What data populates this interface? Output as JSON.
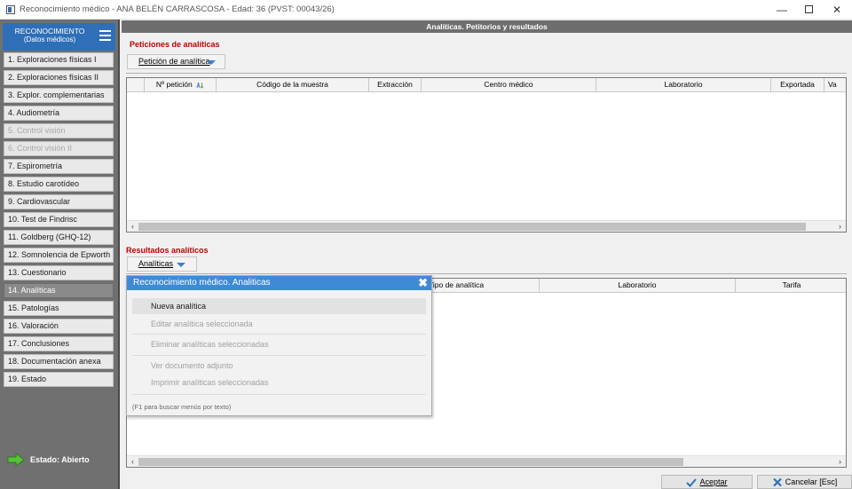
{
  "window": {
    "title": "Reconocimiento médico - ANA BELÉN CARRASCOSA  -  Edad: 36   (PVST: 00043/26)"
  },
  "sidebar": {
    "header_line1": "RECONOCIMIENTO",
    "header_line2": "(Datos médicos)",
    "items": [
      {
        "label": "1. Exploraciones físicas I",
        "state": "enabled"
      },
      {
        "label": "2. Exploraciones físicas II",
        "state": "enabled"
      },
      {
        "label": "3. Explor. complementarias",
        "state": "enabled"
      },
      {
        "label": "4. Audiometría",
        "state": "enabled"
      },
      {
        "label": "5. Control visión",
        "state": "disabled"
      },
      {
        "label": "6. Control visión II",
        "state": "disabled"
      },
      {
        "label": "7. Espirometría",
        "state": "enabled"
      },
      {
        "label": "8. Estudio carotídeo",
        "state": "enabled"
      },
      {
        "label": "9. Cardiovascular",
        "state": "enabled"
      },
      {
        "label": "10. Test de Findrisc",
        "state": "enabled"
      },
      {
        "label": "11. Goldberg (GHQ-12)",
        "state": "enabled"
      },
      {
        "label": "12. Somnolencia de Epworth",
        "state": "enabled"
      },
      {
        "label": "13. Cuestionario",
        "state": "enabled"
      },
      {
        "label": "14. Analíticas",
        "state": "selected"
      },
      {
        "label": "15. Patologías",
        "state": "enabled"
      },
      {
        "label": "16. Valoración",
        "state": "enabled"
      },
      {
        "label": "17. Conclusiones",
        "state": "enabled"
      },
      {
        "label": "18. Documentación anexa",
        "state": "enabled"
      },
      {
        "label": "19. Estado",
        "state": "enabled"
      }
    ],
    "status_label": "Estado: Abierto"
  },
  "main": {
    "header": "Analíticas. Petitorios y resultados",
    "peticiones": {
      "title": "Peticiones de analíticas",
      "button": "Petición de analítica",
      "columns": [
        "Nº petición",
        "Código de la muestra",
        "Extracción",
        "Centro médico",
        "Laboratorio",
        "Exportada",
        "Va"
      ]
    },
    "resultados": {
      "title": "Resultados analíticos",
      "button": "Analíticas",
      "columns": [
        "Tipo de analítica",
        "Laboratorio",
        "Tarifa"
      ]
    }
  },
  "popup": {
    "title": "Reconocimiento médico. Analiticas",
    "items": [
      {
        "label": "Nueva analítica",
        "state": "active"
      },
      {
        "label": "Editar analítica seleccionada",
        "state": "disabled"
      },
      {
        "label": "Eliminar analíticas seleccionadas",
        "state": "disabled"
      },
      {
        "label": "Ver documento adjunto",
        "state": "disabled"
      },
      {
        "label": "Imprimir analíticas seleccionadas",
        "state": "disabled"
      }
    ],
    "hint": "(F1 para buscar menús por texto)"
  },
  "footer": {
    "accept_label": "Aceptar",
    "cancel_label": "Cancelar  [Esc]"
  },
  "colors": {
    "accent": "#2f6fb8",
    "popup_header": "#3d8ad6",
    "section_title": "#c00000",
    "status_arrow": "#5ac23a"
  }
}
